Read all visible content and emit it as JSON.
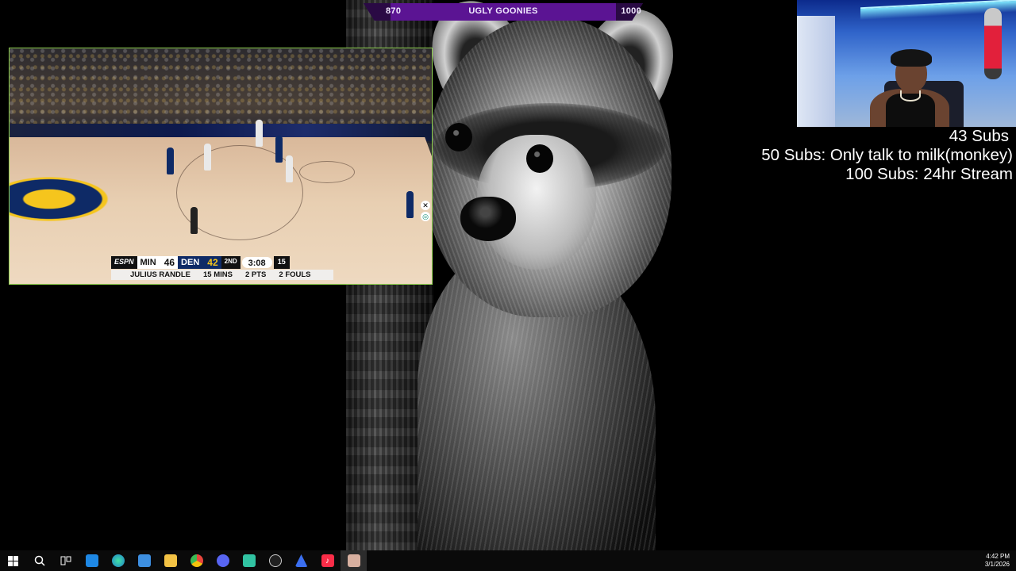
{
  "goal_bar": {
    "current": "870",
    "title": "UGLY GOONIES",
    "target": "1000"
  },
  "scoreboard": {
    "network": "ESPN",
    "away_team": "MIN",
    "away_score": "46",
    "home_team": "DEN",
    "home_score": "42",
    "period": "2ND",
    "clock": "3:08",
    "shot_clock": "15",
    "player_name": "JULIUS RANDLE",
    "player_minutes": "15 MINS",
    "player_points": "2 PTS",
    "player_fouls": "2 FOULS"
  },
  "sub_goals": [
    "43 Subs",
    "50 Subs: Only talk to milk(monkey)",
    "100 Subs: 24hr Stream"
  ],
  "taskbar": {
    "apps": [
      {
        "name": "windows-start",
        "color": "#ffffff"
      },
      {
        "name": "search",
        "color": "#ffffff"
      },
      {
        "name": "task-view",
        "color": "#ffffff"
      },
      {
        "name": "microsoft-store",
        "color": "#1e88e5"
      },
      {
        "name": "edge",
        "color": "#1fa7c9"
      },
      {
        "name": "mail",
        "color": "#3d8fe0"
      },
      {
        "name": "file-explorer",
        "color": "#f3c244"
      },
      {
        "name": "chrome",
        "color": "#e8453c"
      },
      {
        "name": "discord",
        "color": "#5865f2"
      },
      {
        "name": "streamlabs",
        "color": "#31c3a2"
      },
      {
        "name": "obs",
        "color": "#cccccc"
      },
      {
        "name": "app-blue",
        "color": "#3b6ff0"
      },
      {
        "name": "apple-music",
        "color": "#fa2d48"
      },
      {
        "name": "photo-app",
        "color": "#d8b0a0"
      }
    ],
    "time": "4:42 PM",
    "date": "3/1/2026"
  },
  "colors": {
    "goal_bar": "#5b1493",
    "stream_border": "#8fd14f",
    "nuggets_gold": "#f5c51d",
    "nuggets_navy": "#0e2a66"
  }
}
